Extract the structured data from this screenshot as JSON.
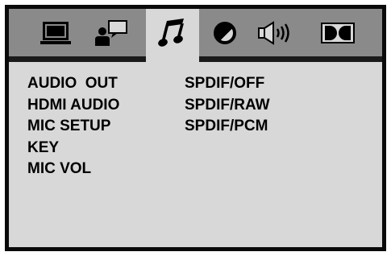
{
  "tabs": [
    {
      "icon": "monitor-icon",
      "active": false
    },
    {
      "icon": "user-chat-icon",
      "active": false
    },
    {
      "icon": "music-note-icon",
      "active": true
    },
    {
      "icon": "no-entry-circle-icon",
      "active": false
    },
    {
      "icon": "speaker-icon",
      "active": false
    },
    {
      "icon": "dolby-icon",
      "active": false
    }
  ],
  "menu": {
    "items": [
      {
        "label": "AUDIO  OUT"
      },
      {
        "label": "HDMI AUDIO"
      },
      {
        "label": "MIC SETUP"
      },
      {
        "label": "KEY"
      },
      {
        "label": "MIC VOL"
      }
    ],
    "options": [
      {
        "label": "SPDIF/OFF"
      },
      {
        "label": "SPDIF/RAW"
      },
      {
        "label": "SPDIF/PCM"
      }
    ]
  },
  "colors": {
    "tabbar": "#8a8a8a",
    "panel": "#d8d8d8",
    "border": "#0a0a0a",
    "text": "#000000"
  }
}
